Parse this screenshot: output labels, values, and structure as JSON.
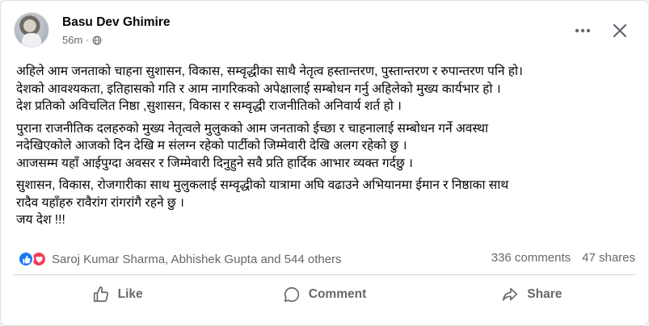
{
  "post": {
    "author": "Basu Dev Ghimire",
    "time": "56m",
    "separator": "·",
    "privacy_icon": "globe-icon",
    "paragraphs": [
      [
        "अहिले आम जनताको चाहना सुशासन, विकास, सम्वृद्धीका साथै नेतृत्व हस्तान्तरण, पुस्तान्तरण र रुपान्तरण पनि हो।",
        "देशको आवश्यकता, इतिहासको गति र आम नागरिकको अपेक्षालाई सम्बोधन गर्नु अहिलेको मुख्य कार्यभार हो ।",
        "देश प्रतिको अविचलित निष्ठा ,सुशासन, विकास र सम्वृद्धी राजनीतिको अनिवार्य शर्त हो ।"
      ],
      [
        "पुराना राजनीतिक दलहरुको मुख्य नेतृत्वले मुलुकको आम जनताको ईच्छा र चाहनालाई सम्बोधन गर्ने  अवस्था",
        "नदेखिएकोले आजको दिन देखि म संलग्न रहेको पार्टीको जिम्मेवारी देखि अलग रहेको छु ।",
        "आजसम्म यहाँ आईपुग्दा अवसर र जिम्मेवारी दिनुहुने सवै प्रति हार्दिक आभार व्यक्त गर्दछु ।"
      ],
      [
        "सुशासन, विकास, रोजगारीका साथ मुलुकलाई सम्वृद्धीको यात्रामा अघि वढाउने अभियानमा ईमान र निष्ठाका साथ",
        "रादैव यहाँहरु रावैरांग रांगरांगै रहने छु ।",
        "जय देश !!!"
      ]
    ]
  },
  "stats": {
    "reactions": [
      "like",
      "love"
    ],
    "reacted_by": "Saroj Kumar Sharma, Abhishek Gupta and 544 others",
    "comments": "336 comments",
    "shares": "47 shares"
  },
  "actions": {
    "like": "Like",
    "comment": "Comment",
    "share": "Share"
  },
  "colors": {
    "like_blue": "#1877f2",
    "love_red": "#f33e58",
    "secondary_text": "#65676b"
  }
}
